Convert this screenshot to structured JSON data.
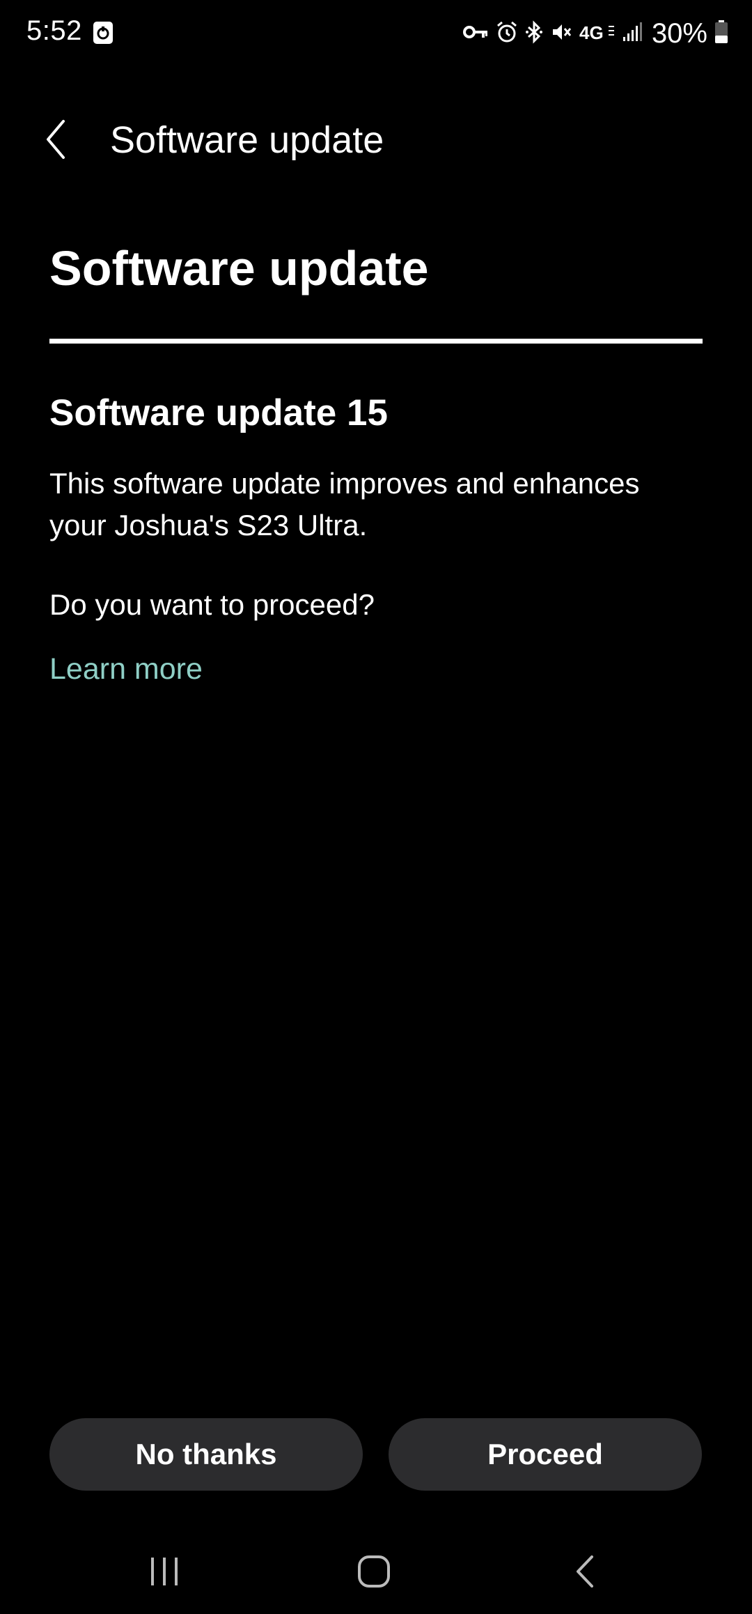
{
  "status_bar": {
    "time": "5:52",
    "battery_percent": "30%",
    "network": "4G",
    "icons": [
      "notification-app-icon",
      "vpn-key-icon",
      "alarm-icon",
      "bluetooth-icon",
      "vibrate-mute-icon",
      "network-4g-lte-icon",
      "signal-icon",
      "battery-icon"
    ]
  },
  "app_bar": {
    "title": "Software update",
    "back_icon": "back-chevron-icon"
  },
  "content": {
    "large_title": "Software update",
    "update_heading": "Software update 15",
    "description": "This software update improves and enhances your Joshua's S23 Ultra.",
    "question": "Do you want to proceed?",
    "learn_more": "Learn more"
  },
  "actions": {
    "no_thanks": "No thanks",
    "proceed": "Proceed"
  },
  "nav_bar": {
    "icons": [
      "recents-icon",
      "home-icon",
      "back-icon"
    ]
  },
  "colors": {
    "background": "#000000",
    "text": "#ffffff",
    "link": "#8fcfc6",
    "button_bg": "#2c2c2e"
  }
}
